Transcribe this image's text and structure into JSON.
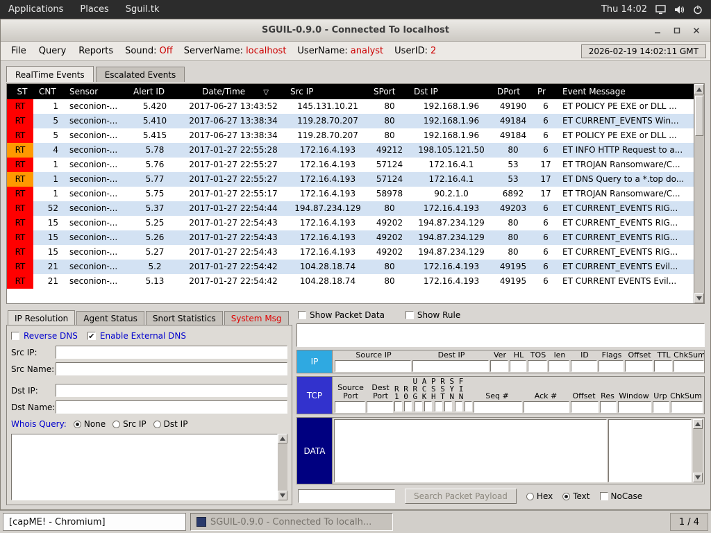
{
  "desktop": {
    "top_panel": {
      "menus": [
        "Applications",
        "Places",
        "Sguil.tk"
      ],
      "clock": "Thu 14:02",
      "icons": [
        "display-icon",
        "volume-icon",
        "power-icon"
      ]
    },
    "taskbar": {
      "button1": "[capME! - Chromium]",
      "button2": "SGUIL-0.9.0 - Connected To localh...",
      "pager": "1 / 4"
    }
  },
  "window": {
    "title": "SGUIL-0.9.0 - Connected To localhost",
    "menubar": {
      "items": [
        "File",
        "Query",
        "Reports"
      ],
      "sound_label": "Sound:",
      "sound_value": "Off",
      "server_label": "ServerName:",
      "server_value": "localhost",
      "user_label": "UserName:",
      "user_value": "analyst",
      "userid_label": "UserID:",
      "userid_value": "2",
      "clock": "2026-02-19 14:02:11 GMT"
    },
    "tabs": [
      "RealTime Events",
      "Escalated Events"
    ]
  },
  "events": {
    "columns": [
      "ST",
      "CNT",
      "Sensor",
      "Alert ID",
      "Date/Time",
      "Src IP",
      "SPort",
      "Dst IP",
      "DPort",
      "Pr",
      "Event Message"
    ],
    "sort_indicator": "▽",
    "rows": [
      {
        "st": "RT",
        "sev": "red",
        "cnt": "1",
        "sensor": "seconion-...",
        "alert_id": "5.420",
        "datetime": "2017-06-27 13:43:52",
        "src_ip": "145.131.10.21",
        "sport": "80",
        "dst_ip": "192.168.1.96",
        "dport": "49190",
        "pr": "6",
        "msg": "ET POLICY PE EXE or DLL ..."
      },
      {
        "st": "RT",
        "sev": "red",
        "cnt": "5",
        "sensor": "seconion-...",
        "alert_id": "5.410",
        "datetime": "2017-06-27 13:38:34",
        "src_ip": "119.28.70.207",
        "sport": "80",
        "dst_ip": "192.168.1.96",
        "dport": "49184",
        "pr": "6",
        "msg": "ET CURRENT_EVENTS Win..."
      },
      {
        "st": "RT",
        "sev": "red",
        "cnt": "5",
        "sensor": "seconion-...",
        "alert_id": "5.415",
        "datetime": "2017-06-27 13:38:34",
        "src_ip": "119.28.70.207",
        "sport": "80",
        "dst_ip": "192.168.1.96",
        "dport": "49184",
        "pr": "6",
        "msg": "ET POLICY PE EXE or DLL ..."
      },
      {
        "st": "RT",
        "sev": "orange",
        "cnt": "4",
        "sensor": "seconion-...",
        "alert_id": "5.78",
        "datetime": "2017-01-27 22:55:28",
        "src_ip": "172.16.4.193",
        "sport": "49212",
        "dst_ip": "198.105.121.50",
        "dport": "80",
        "pr": "6",
        "msg": "ET INFO HTTP Request to a..."
      },
      {
        "st": "RT",
        "sev": "red",
        "cnt": "1",
        "sensor": "seconion-...",
        "alert_id": "5.76",
        "datetime": "2017-01-27 22:55:27",
        "src_ip": "172.16.4.193",
        "sport": "57124",
        "dst_ip": "172.16.4.1",
        "dport": "53",
        "pr": "17",
        "msg": "ET TROJAN Ransomware/C..."
      },
      {
        "st": "RT",
        "sev": "orange",
        "cnt": "1",
        "sensor": "seconion-...",
        "alert_id": "5.77",
        "datetime": "2017-01-27 22:55:27",
        "src_ip": "172.16.4.193",
        "sport": "57124",
        "dst_ip": "172.16.4.1",
        "dport": "53",
        "pr": "17",
        "msg": "ET DNS Query to a *.top do..."
      },
      {
        "st": "RT",
        "sev": "red",
        "cnt": "1",
        "sensor": "seconion-...",
        "alert_id": "5.75",
        "datetime": "2017-01-27 22:55:17",
        "src_ip": "172.16.4.193",
        "sport": "58978",
        "dst_ip": "90.2.1.0",
        "dport": "6892",
        "pr": "17",
        "msg": "ET TROJAN Ransomware/C..."
      },
      {
        "st": "RT",
        "sev": "red",
        "cnt": "52",
        "sensor": "seconion-...",
        "alert_id": "5.37",
        "datetime": "2017-01-27 22:54:44",
        "src_ip": "194.87.234.129",
        "sport": "80",
        "dst_ip": "172.16.4.193",
        "dport": "49203",
        "pr": "6",
        "msg": "ET CURRENT_EVENTS RIG..."
      },
      {
        "st": "RT",
        "sev": "red",
        "cnt": "15",
        "sensor": "seconion-...",
        "alert_id": "5.25",
        "datetime": "2017-01-27 22:54:43",
        "src_ip": "172.16.4.193",
        "sport": "49202",
        "dst_ip": "194.87.234.129",
        "dport": "80",
        "pr": "6",
        "msg": "ET CURRENT_EVENTS RIG..."
      },
      {
        "st": "RT",
        "sev": "red",
        "cnt": "15",
        "sensor": "seconion-...",
        "alert_id": "5.26",
        "datetime": "2017-01-27 22:54:43",
        "src_ip": "172.16.4.193",
        "sport": "49202",
        "dst_ip": "194.87.234.129",
        "dport": "80",
        "pr": "6",
        "msg": "ET CURRENT_EVENTS RIG..."
      },
      {
        "st": "RT",
        "sev": "red",
        "cnt": "15",
        "sensor": "seconion-...",
        "alert_id": "5.27",
        "datetime": "2017-01-27 22:54:43",
        "src_ip": "172.16.4.193",
        "sport": "49202",
        "dst_ip": "194.87.234.129",
        "dport": "80",
        "pr": "6",
        "msg": "ET CURRENT_EVENTS RIG..."
      },
      {
        "st": "RT",
        "sev": "red",
        "cnt": "21",
        "sensor": "seconion-...",
        "alert_id": "5.2",
        "datetime": "2017-01-27 22:54:42",
        "src_ip": "104.28.18.74",
        "sport": "80",
        "dst_ip": "172.16.4.193",
        "dport": "49195",
        "pr": "6",
        "msg": "ET CURRENT_EVENTS Evil..."
      },
      {
        "st": "RT",
        "sev": "red",
        "cnt": "21",
        "sensor": "seconion-...",
        "alert_id": "5.13",
        "datetime": "2017-01-27 22:54:42",
        "src_ip": "104.28.18.74",
        "sport": "80",
        "dst_ip": "172.16.4.193",
        "dport": "49195",
        "pr": "6",
        "msg": "ET CURRENT EVENTS Evil..."
      }
    ]
  },
  "left_panel": {
    "tabs": [
      "IP Resolution",
      "Agent Status",
      "Snort Statistics",
      "System Msg"
    ],
    "reverse_dns": "Reverse DNS",
    "external_dns": "Enable External DNS",
    "fields": {
      "src_ip": "Src IP:",
      "src_name": "Src Name:",
      "dst_ip": "Dst IP:",
      "dst_name": "Dst Name:"
    },
    "whois_label": "Whois Query:",
    "whois_options": [
      "None",
      "Src IP",
      "Dst IP"
    ]
  },
  "packet_panel": {
    "show_packet_data": "Show Packet Data",
    "show_rule": "Show Rule",
    "ip": {
      "label": "IP",
      "headers": [
        "Source IP",
        "Dest IP",
        "Ver",
        "HL",
        "TOS",
        "len",
        "ID",
        "Flags",
        "Offset",
        "TTL",
        "ChkSum"
      ]
    },
    "tcp": {
      "label": "TCP",
      "src_header": "Source Port",
      "dst_header": "Dest Port",
      "flag_rows": [
        "    U A P R S F",
        "R R R C S S Y I",
        "1 0 G K H T N N"
      ],
      "headers": [
        "Seq #",
        "Ack #",
        "Offset",
        "Res",
        "Window",
        "Urp",
        "ChkSum"
      ]
    },
    "data_label": "DATA",
    "search_button": "Search Packet Payload",
    "hex_label": "Hex",
    "text_label": "Text",
    "nocase_label": "NoCase"
  }
}
